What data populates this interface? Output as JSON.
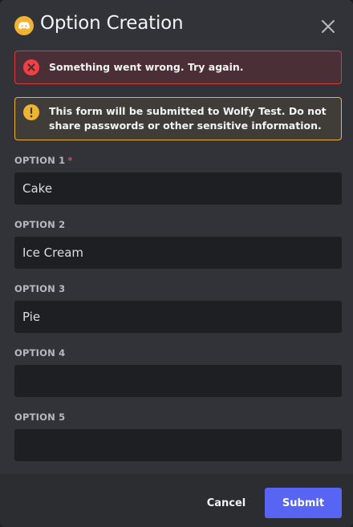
{
  "modal": {
    "title": "Option Creation",
    "app_icon": "discord-logo-icon",
    "close_icon": "close-icon"
  },
  "error_alert": {
    "icon": "error-circle-x-icon",
    "message": "Something went wrong. Try again."
  },
  "warning_alert": {
    "icon": "warning-exclamation-icon",
    "text_before": "This form will be submitted to ",
    "app_name": "Wolfy Test",
    "text_after": ". Do not share passwords or other sensitive information."
  },
  "fields": [
    {
      "label": "OPTION 1",
      "required_marker": "*",
      "value": "Cake",
      "placeholder": ""
    },
    {
      "label": "OPTION 2",
      "value": "Ice Cream",
      "placeholder": ""
    },
    {
      "label": "OPTION 3",
      "value": "Pie",
      "placeholder": ""
    },
    {
      "label": "OPTION 4",
      "value": "",
      "placeholder": ""
    },
    {
      "label": "OPTION 5",
      "value": "",
      "placeholder": ""
    }
  ],
  "footer": {
    "cancel_label": "Cancel",
    "submit_label": "Submit"
  },
  "colors": {
    "modal_bg": "#313338",
    "input_bg": "#1e1f22",
    "footer_bg": "#2b2d31",
    "brand_blurple": "#5865f2",
    "error_red": "#d83c3e",
    "warning_yellow": "#f0b232",
    "required_red": "#f23f42"
  }
}
